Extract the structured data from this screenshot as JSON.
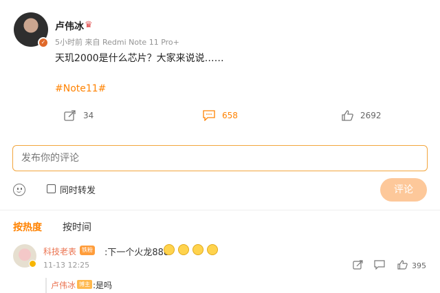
{
  "post": {
    "author": "卢伟冰",
    "meta": "5小时前 来自 Redmi Note 11 Pro+",
    "content": "天玑2000是什么芯片？大家来说说……",
    "hashtag": "#Note11#",
    "forward_count": "34",
    "comment_count": "658",
    "like_count": "2692"
  },
  "composer": {
    "placeholder": "发布你的评论",
    "forward_label": "同时转发",
    "submit_label": "评论"
  },
  "sort": {
    "hot_label": "按热度",
    "time_label": "按时间"
  },
  "comments": [
    {
      "name": "科技老表",
      "badge": "铁粉",
      "text": ":下一个火龙888",
      "time": "11-13 12:25",
      "like_count": "395",
      "replies": [
        {
          "name": "卢伟冰",
          "badge": "博主",
          "text": ":是吗"
        }
      ]
    }
  ],
  "colors": {
    "accent": "#ff8200",
    "input_border": "#f2a53c",
    "submit_bg": "#fdc89a",
    "username": "#eb7350"
  },
  "icons": [
    "verified-badge-icon",
    "crown-icon",
    "forward-icon",
    "comment-icon",
    "like-icon",
    "emoji-icon",
    "checkbox-icon"
  ]
}
